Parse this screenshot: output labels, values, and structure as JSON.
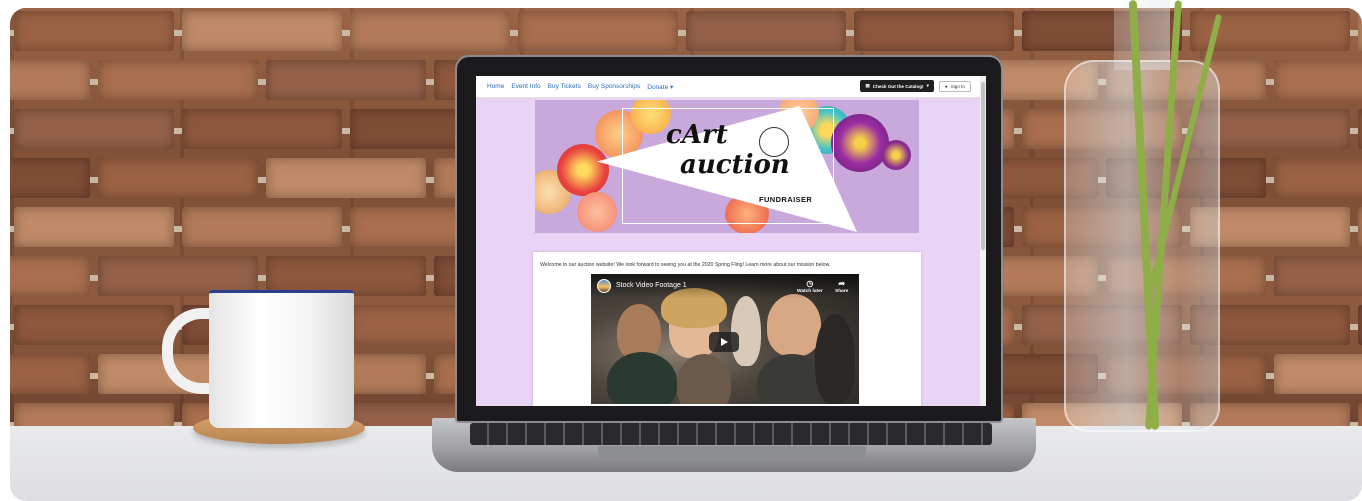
{
  "nav": {
    "links": [
      "Home",
      "Event Info",
      "Buy Tickets",
      "Buy Sponsorships",
      "Donate ▾"
    ],
    "catalog_button": "Check Out the Catalog!",
    "signin_button": "Sign In"
  },
  "banner": {
    "title_line1": "cArt",
    "title_line2": "auction",
    "subtitle": "FUNDRAISER"
  },
  "welcome_text": "Welcome to our auction website! We look forward to seeing you at the 2020 Spring Fling! Learn more about our mission below.",
  "video": {
    "title": "Stock Video Footage 1",
    "watch_later": "Watch later",
    "share": "Share"
  },
  "icons": {
    "catalog": "book-icon",
    "signin": "user-icon",
    "watch_later": "clock-icon",
    "share": "share-arrow-icon",
    "play": "play-icon"
  },
  "colors": {
    "page_background": "#ead4f6",
    "nav_link": "#2f6fb5",
    "catalog_button": "#1f1f1f"
  }
}
